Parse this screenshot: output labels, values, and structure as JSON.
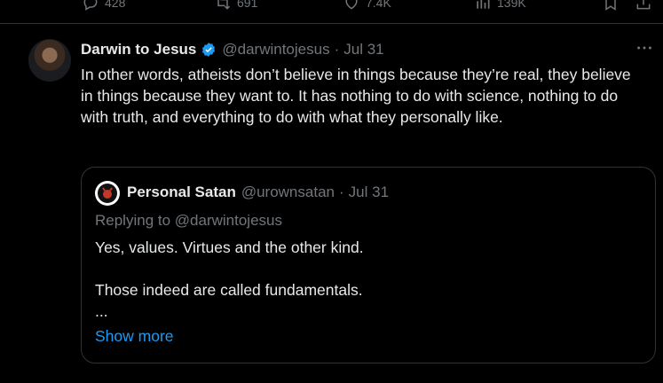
{
  "prev_actions": {
    "replies": "428",
    "reposts": "691",
    "likes": "7.4K",
    "views": "139K"
  },
  "tweet": {
    "author_name": "Darwin to Jesus",
    "handle": "@darwintojesus",
    "separator": "·",
    "date": "Jul 31",
    "text": "In other words, atheists don’t believe in things because they’re real, they believe in things because they want to. It has nothing to do with science, nothing to do with truth, and everything to do with what they personally like."
  },
  "quote": {
    "author_name": "Personal Satan",
    "handle": "@urownsatan",
    "separator": "·",
    "date": "Jul 31",
    "replying_to": "Replying to @darwintojesus",
    "text": "Yes, values. Virtues and the other kind.\n\nThose indeed are called fundamentals.\n...",
    "show_more": "Show more"
  },
  "icons": {
    "verified_color": "#1d9bf0",
    "link_color": "#1d9bf0",
    "muted_color": "#71767b"
  }
}
